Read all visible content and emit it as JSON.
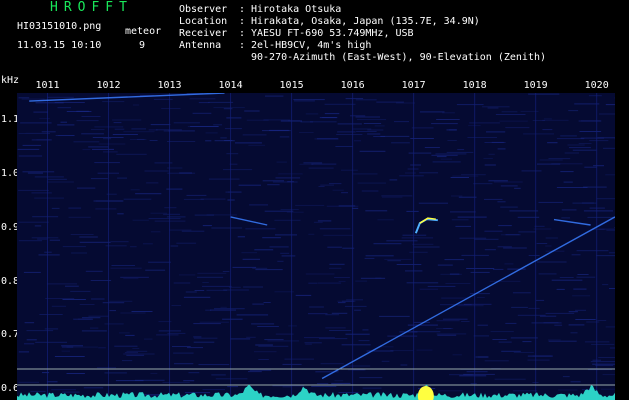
{
  "header": {
    "app_title": "HROFFT",
    "file_name": "HI03151010.png",
    "type_label": "meteor",
    "datetime": "11.03.15 10:10",
    "count": "9"
  },
  "station_info": [
    {
      "key": "Observer",
      "value": "Hirotaka Otsuka"
    },
    {
      "key": "Location",
      "value": "Hirakata, Osaka, Japan (135.7E, 34.9N)"
    },
    {
      "key": "Receiver",
      "value": "YAESU FT-690 53.749MHz, USB"
    },
    {
      "key": "Antenna",
      "value": "2el-HB9CV, 4m's high"
    },
    {
      "key": "",
      "value": "90-270-Azimuth (East-West), 90-Elevation (Zenith)"
    }
  ],
  "chart_data": {
    "type": "heatmap",
    "ylabel": "kHz",
    "x_ticks": [
      "1011",
      "1012",
      "1013",
      "1014",
      "1015",
      "1016",
      "1017",
      "1018",
      "1019",
      "1020"
    ],
    "y_ticks": [
      "1.1",
      "1.0",
      "0.9",
      "0.8",
      "0.7",
      "0.6"
    ],
    "xlim": [
      1010.5,
      1020.3
    ],
    "ylim": [
      0.58,
      1.15
    ],
    "background_color": "#050a32",
    "trace_color": "#3a7cff",
    "echo_color": "#ffff40",
    "traces": [
      {
        "name": "",
        "points": [
          [
            1010.7,
            1.135
          ],
          [
            1013.9,
            1.15
          ]
        ]
      },
      {
        "name": "",
        "points": [
          [
            1014.0,
            0.92
          ],
          [
            1014.6,
            0.905
          ]
        ]
      },
      {
        "name": "",
        "points": [
          [
            1015.5,
            0.62
          ],
          [
            1020.3,
            0.92
          ]
        ]
      },
      {
        "name": "",
        "points": [
          [
            1019.3,
            0.915
          ],
          [
            1019.9,
            0.905
          ]
        ]
      }
    ],
    "meteor_echo": {
      "x": 1017.2,
      "y": 0.912
    },
    "amplitude_bursts": [
      1014.3,
      1015.2,
      1017.2,
      1019.9
    ]
  }
}
